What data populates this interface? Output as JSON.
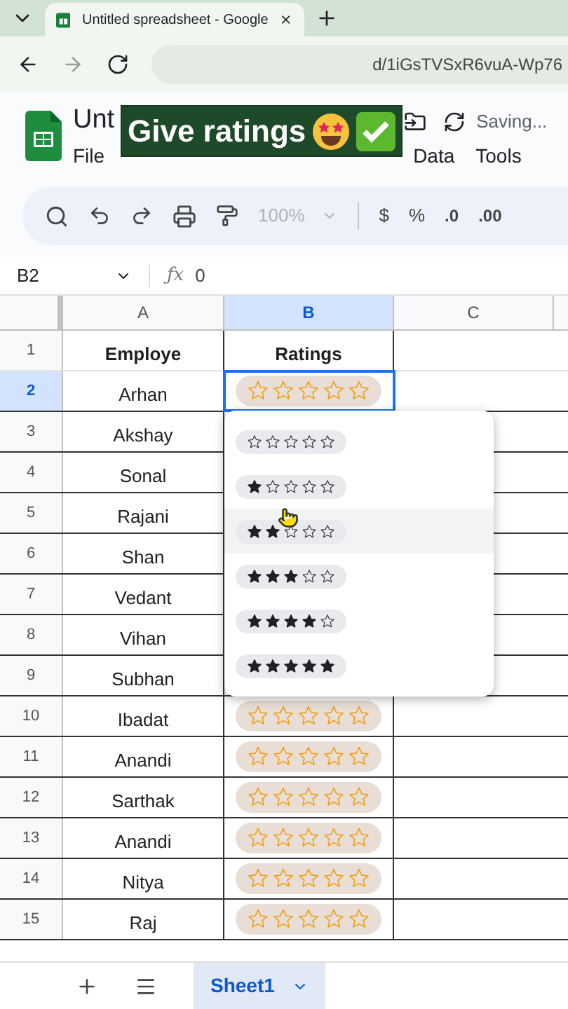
{
  "browser": {
    "tab_title": "Untitled spreadsheet - Google",
    "url": "d/1iGsTVSxR6vuA-Wp76"
  },
  "caption": "Give ratings",
  "doc": {
    "title": "Unt",
    "status": "Saving...",
    "menu_left": [
      "File"
    ],
    "menu_right": [
      "Data",
      "Tools"
    ]
  },
  "toolbar": {
    "zoom": "100%",
    "currency": "$",
    "percent": "%",
    "decrease_decimal": ".0",
    "increase_decimal": ".00"
  },
  "formula_bar": {
    "cell_ref": "B2",
    "fx_label": "ƒx",
    "value": "0"
  },
  "columns": [
    {
      "label": "A",
      "selected": false
    },
    {
      "label": "B",
      "selected": true
    },
    {
      "label": "C",
      "selected": false
    }
  ],
  "header_row": {
    "number": "1",
    "name": "Employe",
    "rating": "Ratings"
  },
  "rows": [
    {
      "number": "2",
      "name": "Arhan",
      "stars": 0,
      "selected": true
    },
    {
      "number": "3",
      "name": "Akshay",
      "selected": false
    },
    {
      "number": "4",
      "name": "Sonal",
      "selected": false
    },
    {
      "number": "5",
      "name": "Rajani",
      "selected": false
    },
    {
      "number": "6",
      "name": "Shan",
      "selected": false
    },
    {
      "number": "7",
      "name": "Vedant",
      "selected": false
    },
    {
      "number": "8",
      "name": "Vihan",
      "selected": false
    },
    {
      "number": "9",
      "name": "Subhan",
      "selected": false
    },
    {
      "number": "10",
      "name": "Ibadat",
      "stars": 0,
      "selected": false
    },
    {
      "number": "11",
      "name": "Anandi",
      "stars": 0,
      "selected": false
    },
    {
      "number": "12",
      "name": "Sarthak",
      "stars": 0,
      "selected": false
    },
    {
      "number": "13",
      "name": "Anandi",
      "stars": 0,
      "selected": false
    },
    {
      "number": "14",
      "name": "Nitya",
      "stars": 0,
      "selected": false
    },
    {
      "number": "15",
      "name": "Raj",
      "stars": 0,
      "selected": false
    }
  ],
  "dropdown": [
    {
      "stars": 0,
      "selected": false
    },
    {
      "stars": 1,
      "selected": false
    },
    {
      "stars": 2,
      "selected": true
    },
    {
      "stars": 3,
      "selected": false
    },
    {
      "stars": 4,
      "selected": false
    },
    {
      "stars": 5,
      "selected": false
    }
  ],
  "sheet_tabs": [
    {
      "label": "Sheet1",
      "selected": true
    }
  ]
}
